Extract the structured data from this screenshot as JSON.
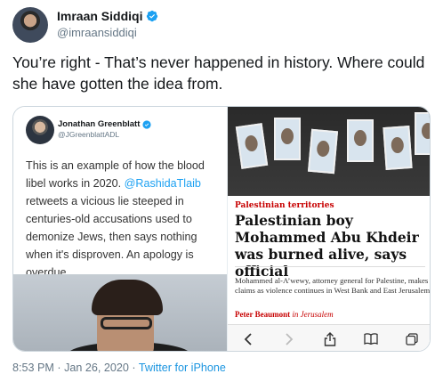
{
  "author": {
    "display_name": "Imraan Siddiqi",
    "handle": "@imraansiddiqi"
  },
  "tweet": {
    "text": "You’re right - That’s never happened in history. Where could she have gotten the idea from."
  },
  "embedded_tweet": {
    "name": "Jonathan Greenblatt",
    "handle": "@JGreenblattADL",
    "text_before": "This is an example of how the blood libel works in 2020. ",
    "mention": "@RashidaTlaib",
    "text_after": " retweets a vicious lie steeped in centuries-old accusations used to demonize Jews, then says nothing when it's disproven. An apology is overdue."
  },
  "news_article": {
    "category": "Palestinian territories",
    "headline": "Palestinian boy Mohammed Abu Khdeir was burned alive, says official",
    "standfirst": "Mohammed al-A’wewy, attorney general for Palestine, makes claims as violence continues in West Bank and East Jerusalem",
    "byline_author": "Peter Beaumont",
    "byline_location": "in Jerusalem"
  },
  "browser_toolbar": {
    "icons": [
      "chevron-left-icon",
      "chevron-right-icon",
      "share-icon",
      "bookmarks-icon",
      "tabs-icon"
    ]
  },
  "meta": {
    "timestamp": "8:53 PM · Jan 26, 2020 · ",
    "source": "Twitter for iPhone"
  },
  "colors": {
    "accent": "#1da1f2",
    "guardian_red": "#c70000",
    "muted": "#657786"
  }
}
